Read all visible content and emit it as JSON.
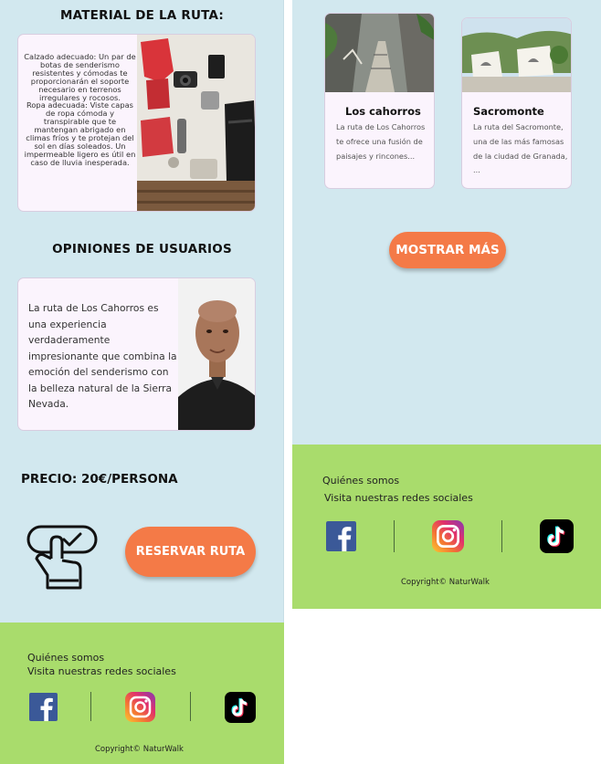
{
  "material": {
    "title": "MATERIAL DE LA RUTA:",
    "paragraphs": [
      "Calzado adecuado: Un par de botas de senderismo resistentes y cómodas te proporcionarán el soporte necesario en terrenos irregulares y rocosos.",
      "Ropa adecuada: Viste capas de ropa cómoda y transpirable que te mantengan abrigado en climas fríos y te protejan del sol en días soleados. Un impermeable ligero es útil en caso de lluvia inesperada."
    ],
    "image_icon": "hiking-gear-flatlay-photo"
  },
  "opinions": {
    "title": "OPINIONES DE USUARIOS",
    "text": "La ruta de Los Cahorros es una experiencia verdaderamente impresionante que combina la emoción del senderismo con la belleza natural de la Sierra Nevada.",
    "image_icon": "user-portrait-photo"
  },
  "price": {
    "label": "PRECIO: 20€/PERSONA"
  },
  "reserve": {
    "label": "RESERVAR RUTA",
    "icon": "hand-touch-check-icon"
  },
  "routes": [
    {
      "name": "Los cahorros",
      "desc": "La ruta de Los Cahorros te ofrece una fusión de paisajes y rincones..."
    },
    {
      "name": "Sacromonte",
      "desc": "La ruta del Sacromonte, una de las más famosas de la ciudad de Granada, ..."
    }
  ],
  "show_more": {
    "label": "MOSTRAR MÁS"
  },
  "footer": {
    "about": "Quiénes somos",
    "social": "Visita nuestras redes sociales",
    "copyright": "Copyright© NaturWalk",
    "icons": [
      "facebook-icon",
      "instagram-icon",
      "tiktok-icon"
    ]
  },
  "colors": {
    "panel_bg": "#d2e8ef",
    "card_bg": "#fbf4fd",
    "accent_orange": "#f47a47",
    "footer_green": "#a9dc6c"
  }
}
